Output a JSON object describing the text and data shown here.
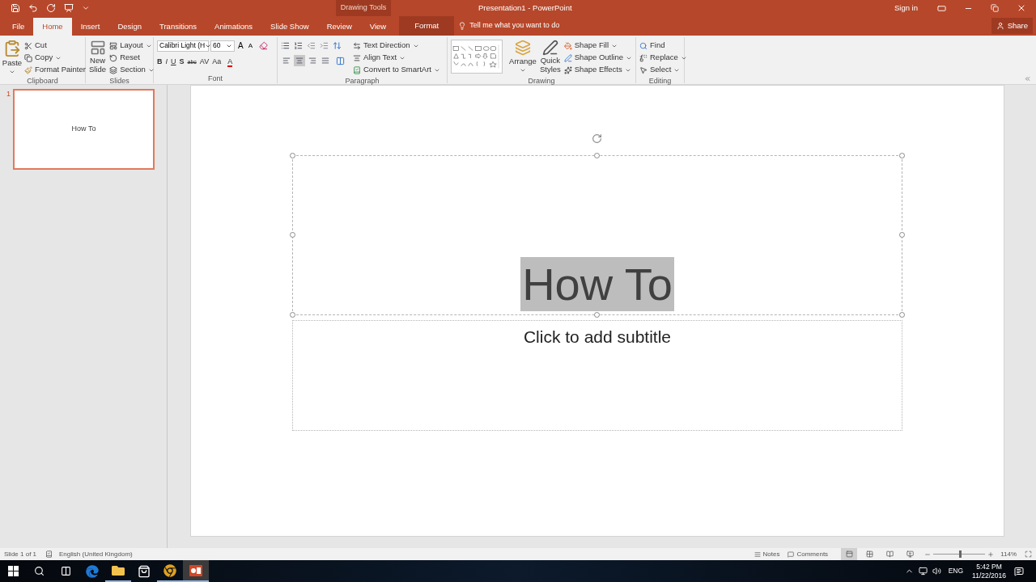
{
  "window": {
    "title": "Presentation1 - PowerPoint",
    "sign_in": "Sign in",
    "contextual_group": "Drawing Tools"
  },
  "tabs": [
    {
      "label": "File",
      "selected": false,
      "kind": "normal"
    },
    {
      "label": "Home",
      "selected": true,
      "kind": "normal"
    },
    {
      "label": "Insert",
      "selected": false,
      "kind": "normal"
    },
    {
      "label": "Design",
      "selected": false,
      "kind": "normal"
    },
    {
      "label": "Transitions",
      "selected": false,
      "kind": "normal"
    },
    {
      "label": "Animations",
      "selected": false,
      "kind": "normal"
    },
    {
      "label": "Slide Show",
      "selected": false,
      "kind": "normal"
    },
    {
      "label": "Review",
      "selected": false,
      "kind": "normal"
    },
    {
      "label": "View",
      "selected": false,
      "kind": "normal"
    },
    {
      "label": "Format",
      "selected": false,
      "kind": "contextual"
    }
  ],
  "tell_me": {
    "placeholder": "Tell me what you want to do"
  },
  "share": "Share",
  "ribbon": {
    "clipboard": {
      "label": "Clipboard",
      "paste": "Paste",
      "items": [
        "Cut",
        "Copy",
        "Format Painter"
      ]
    },
    "slides": {
      "label": "Slides",
      "new_slide": "New Slide",
      "items": [
        "Layout",
        "Reset",
        "Section"
      ]
    },
    "font": {
      "label": "Font",
      "face": "Calibri Light (H",
      "size": "60",
      "grow": "A",
      "shrink": "A",
      "styles": [
        "B",
        "I",
        "U",
        "S",
        "abc",
        "AV",
        "Aa"
      ],
      "color_button": "A"
    },
    "paragraph": {
      "label": "Paragraph",
      "alignments": [
        {
          "selected": false
        },
        {
          "selected": true
        },
        {
          "selected": false
        },
        {
          "selected": false
        }
      ],
      "items": [
        "Text Direction",
        "Align Text",
        "Convert to SmartArt"
      ]
    },
    "drawing": {
      "label": "Drawing",
      "arrange": "Arrange",
      "quick_styles": "Quick Styles",
      "items": [
        "Shape Fill",
        "Shape Outline",
        "Shape Effects"
      ]
    },
    "editing": {
      "label": "Editing",
      "items": [
        "Find",
        "Replace",
        "Select"
      ]
    }
  },
  "thumbnails": [
    {
      "number": "1",
      "title": "How To",
      "selected": true
    }
  ],
  "slide": {
    "title": "How To",
    "title_selected": true,
    "subtitle_placeholder": "Click to add subtitle"
  },
  "status_bar": {
    "slide": "Slide 1 of 1",
    "language": "English (United Kingdom)",
    "notes": "Notes",
    "comments": "Comments",
    "views": [
      {
        "selected": true
      },
      {
        "selected": false
      },
      {
        "selected": false
      },
      {
        "selected": false
      }
    ],
    "zoom": {
      "level": 0.52,
      "reading": "114%"
    }
  },
  "taskbar": {
    "apps": [
      {
        "kind": "edge",
        "running": false,
        "selected": false
      },
      {
        "kind": "explorer",
        "running": true,
        "selected": false
      },
      {
        "kind": "store",
        "running": false,
        "selected": false
      },
      {
        "kind": "chrome",
        "running": true,
        "selected": false
      },
      {
        "kind": "powerpoint",
        "running": true,
        "selected": true
      }
    ],
    "language": "ENG",
    "time": "5:42 PM",
    "date": "11/22/2016"
  }
}
